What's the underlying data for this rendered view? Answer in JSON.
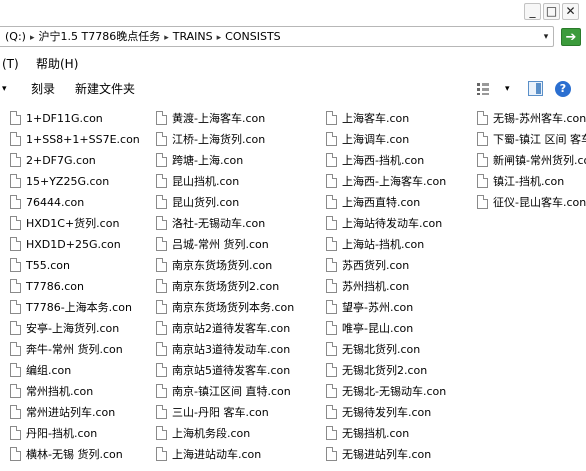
{
  "address": {
    "drive": "(Q:)",
    "crumbs": [
      "沪宁1.5 T7786晚点任务",
      "TRAINS",
      "CONSISTS"
    ],
    "dropdown_glyph": "▾",
    "go_glyph": "➔"
  },
  "window_controls": {
    "minimize": "_",
    "maximize": "□",
    "close": "✕"
  },
  "menu": {
    "tools": "(T)",
    "help": "帮助(H)"
  },
  "toolbar": {
    "burn": "刻录",
    "new_folder": "新建文件夹",
    "arrow": "▾",
    "views_arrow": "▾",
    "help": "?"
  },
  "files": {
    "col1": [
      "1+DF11G.con",
      "1+SS8+1+SS7E.con",
      "2+DF7G.con",
      "15+YZ25G.con",
      "76444.con",
      "HXD1C+货列.con",
      "HXD1D+25G.con",
      "T55.con",
      "T7786.con",
      "T7786-上海本务.con",
      "安亭-上海货列.con",
      "奔牛-常州 货列.con",
      "编组.con",
      "常州挡机.con",
      "常州进站列车.con",
      "丹阳-挡机.con",
      "横林-无锡 货列.con"
    ],
    "col2": [
      "黄渡-上海客车.con",
      "江桥-上海货列.con",
      "跨塘-上海.con",
      "昆山挡机.con",
      "昆山货列.con",
      "洛社-无锡动车.con",
      "吕城-常州 货列.con",
      "南京东货场货列.con",
      "南京东货场货列2.con",
      "南京东货场货列本务.con",
      "南京站2道待发客车.con",
      "南京站3道待发动车.con",
      "南京站5道待发客车.con",
      "南京-镇江区间 直特.con",
      "三山-丹阳 客车.con",
      "上海机务段.con",
      "上海进站动车.con"
    ],
    "col3": [
      "上海客车.con",
      "上海调车.con",
      "上海西-挡机.con",
      "上海西-上海客车.con",
      "上海西直特.con",
      "上海站待发动车.con",
      "上海站-挡机.con",
      "苏西货列.con",
      "苏州挡机.con",
      "望亭-苏州.con",
      "唯亭-昆山.con",
      "无锡北货列.con",
      "无锡北货列2.con",
      "无锡北-无锡动车.con",
      "无锡待发列车.con",
      "无锡挡机.con",
      "无锡进站列车.con"
    ],
    "col4": [
      "无锡-苏州客车.con",
      "下蜀-镇江 区间 客车.con",
      "新闸镇-常州货列.con",
      "镇江-挡机.con",
      "征仪-昆山客车.con"
    ]
  }
}
